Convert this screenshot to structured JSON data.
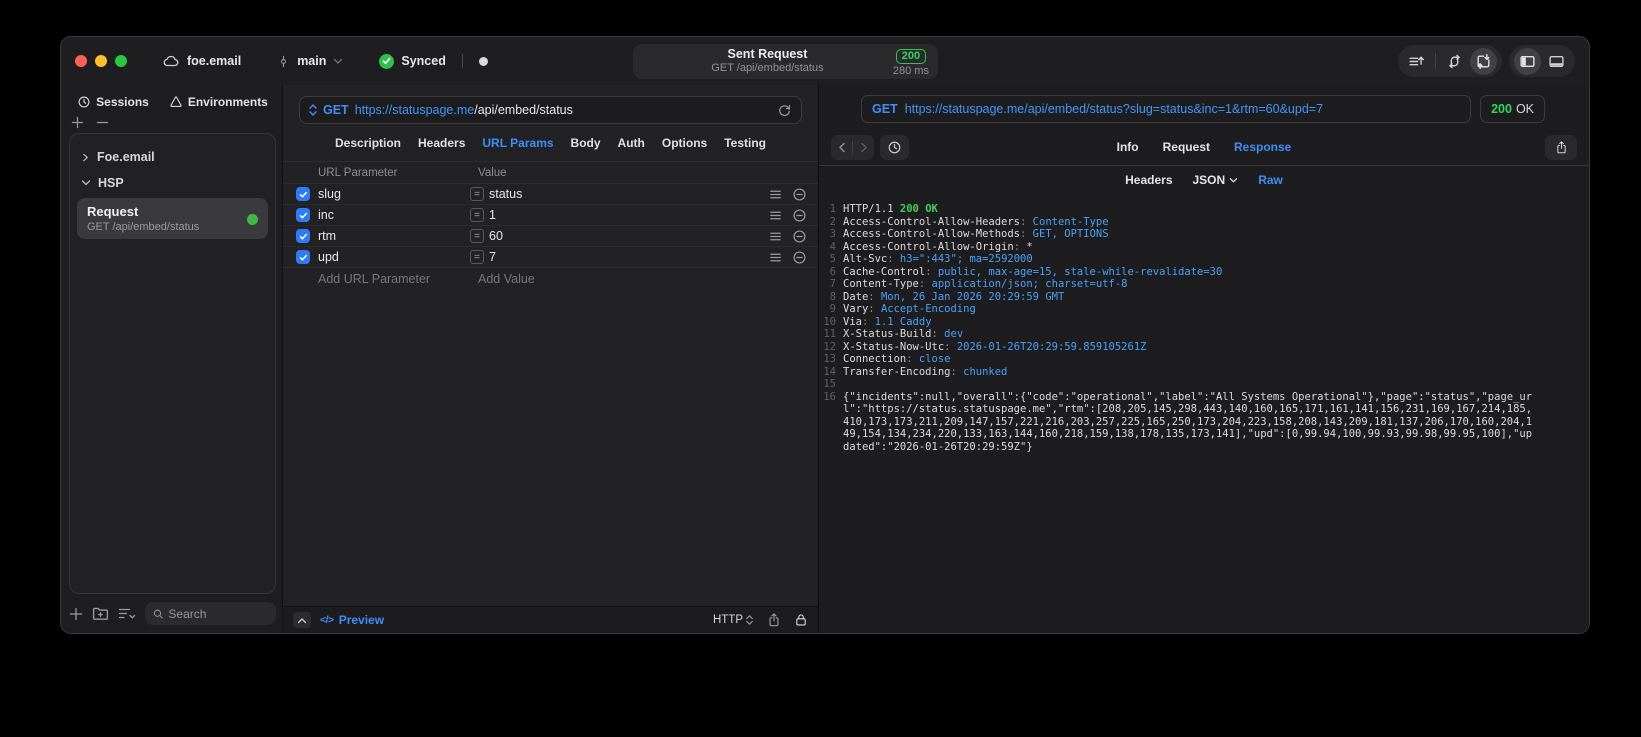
{
  "titlebar": {
    "project": "foe.email",
    "branch": "main",
    "sync_status": "Synced",
    "request_summary": {
      "title": "Sent Request",
      "subtitle": "GET /api/embed/status",
      "status_code": "200",
      "duration": "280 ms"
    }
  },
  "sidebar": {
    "tabs": {
      "sessions": "Sessions",
      "environments": "Environments"
    },
    "tree": [
      {
        "label": "Foe.email"
      },
      {
        "label": "HSP"
      }
    ],
    "request_item": {
      "title": "Request",
      "subtitle": "GET /api/embed/status"
    },
    "search_placeholder": "Search"
  },
  "request_pane": {
    "method": "GET",
    "url_host": "https://statuspage.me",
    "url_path": "/api/embed/status",
    "tabs": [
      "Description",
      "Headers",
      "URL Params",
      "Body",
      "Auth",
      "Options",
      "Testing"
    ],
    "active_tab": "URL Params",
    "table": {
      "col_name": "URL Parameter",
      "col_value": "Value",
      "eq_glyph": "=",
      "rows": [
        {
          "name": "slug",
          "value": "status",
          "enabled": true
        },
        {
          "name": "inc",
          "value": "1",
          "enabled": true
        },
        {
          "name": "rtm",
          "value": "60",
          "enabled": true
        },
        {
          "name": "upd",
          "value": "7",
          "enabled": true
        }
      ],
      "add_name": "Add URL Parameter",
      "add_value": "Add Value"
    },
    "footer": {
      "code_glyph": "</>",
      "preview": "Preview",
      "protocol": "HTTP"
    }
  },
  "response_pane": {
    "method": "GET",
    "request_url": "https://statuspage.me/api/embed/status?slug=status&inc=1&rtm=60&upd=7",
    "status_code": "200",
    "status_text": "OK",
    "tabs": [
      "Info",
      "Request",
      "Response"
    ],
    "active_tab": "Response",
    "subtabs": {
      "headers": "Headers",
      "format": "JSON",
      "raw": "Raw"
    },
    "active_subtab": "Raw",
    "lines": [
      {
        "n": "1",
        "parts": [
          {
            "t": "HTTP/1.1 ",
            "c": ""
          },
          {
            "t": "200 OK",
            "c": "g"
          }
        ]
      },
      {
        "n": "2",
        "parts": [
          {
            "t": "Access-Control-Allow-Headers",
            "c": ""
          },
          {
            "t": ": ",
            "c": "d"
          },
          {
            "t": "Content-Type",
            "c": "v"
          }
        ]
      },
      {
        "n": "3",
        "parts": [
          {
            "t": "Access-Control-Allow-Methods",
            "c": ""
          },
          {
            "t": ": ",
            "c": "d"
          },
          {
            "t": "GET, OPTIONS",
            "c": "v"
          }
        ]
      },
      {
        "n": "4",
        "parts": [
          {
            "t": "Access-Control-Allow-Origin",
            "c": ""
          },
          {
            "t": ": ",
            "c": "d"
          },
          {
            "t": "*",
            "c": ""
          }
        ]
      },
      {
        "n": "5",
        "parts": [
          {
            "t": "Alt-Svc",
            "c": ""
          },
          {
            "t": ": ",
            "c": "d"
          },
          {
            "t": "h3=\":443\"; ma=2592000",
            "c": "v"
          }
        ]
      },
      {
        "n": "6",
        "parts": [
          {
            "t": "Cache-Control",
            "c": ""
          },
          {
            "t": ": ",
            "c": "d"
          },
          {
            "t": "public, max-age=15, stale-while-revalidate=30",
            "c": "v"
          }
        ]
      },
      {
        "n": "7",
        "parts": [
          {
            "t": "Content-Type",
            "c": ""
          },
          {
            "t": ": ",
            "c": "d"
          },
          {
            "t": "application/json; charset=utf-8",
            "c": "v"
          }
        ]
      },
      {
        "n": "8",
        "parts": [
          {
            "t": "Date",
            "c": ""
          },
          {
            "t": ": ",
            "c": "d"
          },
          {
            "t": "Mon, 26 Jan 2026 20:29:59 GMT",
            "c": "v"
          }
        ]
      },
      {
        "n": "9",
        "parts": [
          {
            "t": "Vary",
            "c": ""
          },
          {
            "t": ": ",
            "c": "d"
          },
          {
            "t": "Accept-Encoding",
            "c": "v"
          }
        ]
      },
      {
        "n": "10",
        "parts": [
          {
            "t": "Via",
            "c": ""
          },
          {
            "t": ": ",
            "c": "d"
          },
          {
            "t": "1.1 Caddy",
            "c": "v"
          }
        ]
      },
      {
        "n": "11",
        "parts": [
          {
            "t": "X-Status-Build",
            "c": ""
          },
          {
            "t": ": ",
            "c": "d"
          },
          {
            "t": "dev",
            "c": "v"
          }
        ]
      },
      {
        "n": "12",
        "parts": [
          {
            "t": "X-Status-Now-Utc",
            "c": ""
          },
          {
            "t": ": ",
            "c": "d"
          },
          {
            "t": "2026-01-26T20:29:59.859105261Z",
            "c": "v"
          }
        ]
      },
      {
        "n": "13",
        "parts": [
          {
            "t": "Connection",
            "c": ""
          },
          {
            "t": ": ",
            "c": "d"
          },
          {
            "t": "close",
            "c": "v"
          }
        ]
      },
      {
        "n": "14",
        "parts": [
          {
            "t": "Transfer-Encoding",
            "c": ""
          },
          {
            "t": ": ",
            "c": "d"
          },
          {
            "t": "chunked",
            "c": "v"
          }
        ]
      },
      {
        "n": "15",
        "parts": []
      },
      {
        "n": "16",
        "parts": [
          {
            "t": "{\"incidents\":null,\"overall\":{\"code\":\"operational\",\"label\":\"All Systems Operational\"},\"page\":\"status\",\"page_url\":\"https://status.statuspage.me\",\"rtm\":[208,205,145,298,443,140,160,165,171,161,141,156,231,169,167,214,185,410,173,173,211,209,147,157,221,216,203,257,225,165,250,173,204,223,158,208,143,209,181,137,206,170,160,204,149,154,134,234,220,133,163,144,160,218,159,138,178,135,173,141],\"upd\":[0,99.94,100,99.93,99.98,99.95,100],\"updated\":\"2026-01-26T20:29:59Z\"}",
            "c": ""
          }
        ]
      }
    ]
  },
  "colors": {
    "accent_blue": "#3f8ef6",
    "status_green": "#35d45b",
    "checkbox_blue": "#2f7bf6"
  }
}
